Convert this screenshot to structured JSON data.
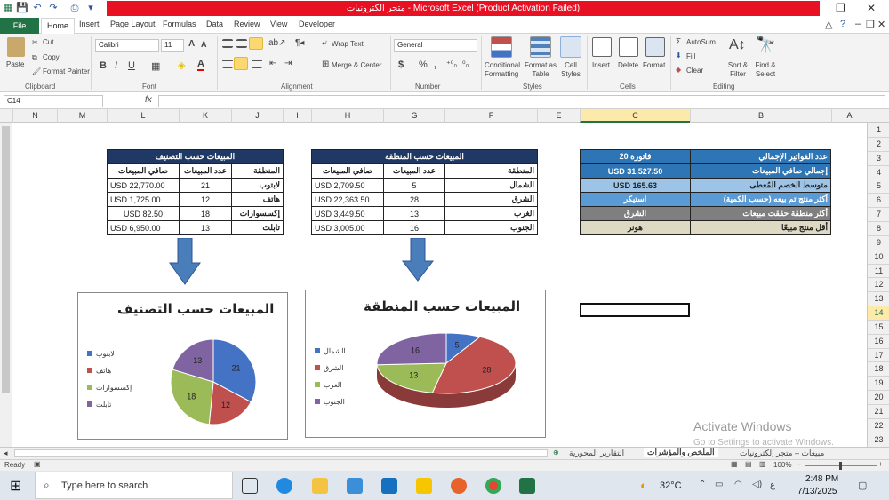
{
  "window": {
    "title": "متجر الكترونيات - Microsoft Excel (Product Activation Failed)"
  },
  "ribbon_tabs": [
    "File",
    "Home",
    "Insert",
    "Page Layout",
    "Formulas",
    "Data",
    "Review",
    "View",
    "Developer"
  ],
  "ribbon": {
    "paste": "Paste",
    "cut": "Cut",
    "copy": "Copy",
    "format_painter": "Format Painter",
    "font_name": "Calibri",
    "font_size": "11",
    "wrap_text": "Wrap Text",
    "merge_center": "Merge & Center",
    "number_format": "General",
    "conditional": "Conditional Formatting",
    "format_table": "Format as Table",
    "cell_styles": "Cell Styles",
    "insert": "Insert",
    "delete": "Delete",
    "format": "Format",
    "autosum": "AutoSum",
    "fill": "Fill",
    "clear": "Clear",
    "sort_filter": "Sort & Filter",
    "find_select": "Find & Select",
    "groups": [
      "Clipboard",
      "Font",
      "Alignment",
      "Number",
      "Styles",
      "Cells",
      "Editing"
    ]
  },
  "formula_bar": {
    "name_box": "C14",
    "fx": "fx",
    "value": ""
  },
  "columns": [
    "N",
    "M",
    "L",
    "K",
    "J",
    "I",
    "H",
    "G",
    "F",
    "E",
    "D",
    "C",
    "B",
    "A"
  ],
  "rows": [
    "1",
    "2",
    "3",
    "4",
    "5",
    "6",
    "7",
    "8",
    "9",
    "10",
    "11",
    "12",
    "13",
    "14",
    "15",
    "16",
    "17",
    "18",
    "19",
    "20",
    "21",
    "22",
    "23"
  ],
  "category_table": {
    "title": "المبيعات حسب التصنيف",
    "headers": [
      "المنطقة",
      "عدد المبيعات",
      "صافي المبيعات"
    ],
    "rows": [
      [
        "لابتوب",
        "21",
        "USD 22,770.00"
      ],
      [
        "هاتف",
        "12",
        "USD 1,725.00"
      ],
      [
        "إكسسوارات",
        "18",
        "USD 82.50"
      ],
      [
        "تابلت",
        "13",
        "USD 6,950.00"
      ]
    ]
  },
  "region_table": {
    "title": "المبيعات حسب المنطقة",
    "headers": [
      "المنطقة",
      "عدد المبيعات",
      "صافي المبيعات"
    ],
    "rows": [
      [
        "الشمال",
        "5",
        "USD 2,709.50"
      ],
      [
        "الشرق",
        "28",
        "USD 22,363.50"
      ],
      [
        "الغرب",
        "13",
        "USD 3,449.50"
      ],
      [
        "الجنوب",
        "16",
        "USD 3,005.00"
      ]
    ]
  },
  "kpi_table": {
    "rows": [
      [
        "عدد الفواتير الإجمالي",
        "فاتورة 20"
      ],
      [
        "إجمالي صافي المبيعات",
        "USD 31,527.50"
      ],
      [
        "متوسط الخصم المُعطى",
        "USD 165.63"
      ],
      [
        "أكثر منتج تم بيعه (حسب الكمية)",
        "استيكر"
      ],
      [
        "أكثر منطقة حققت مبيعات",
        "الشرق"
      ],
      [
        "أقل منتج مبيعًا",
        "هونر"
      ]
    ],
    "colors": {
      "label_bg": [
        "#2e75b6",
        "#2e75b6",
        "#9dc3e6",
        "#5b9bd5",
        "#7f7f7f",
        "#ddd9c3"
      ],
      "value_bg": [
        "#2e75b6",
        "#2e75b6",
        "#9dc3e6",
        "#5b9bd5",
        "#7f7f7f",
        "#ddd9c3"
      ]
    }
  },
  "chart_data": [
    {
      "type": "pie",
      "title": "المبيعات حسب التصنيف",
      "categories": [
        "لابتوب",
        "هاتف",
        "إكسسوارات",
        "تابلت"
      ],
      "values": [
        21,
        12,
        18,
        13
      ],
      "colors": [
        "#4472c4",
        "#c0504d",
        "#9bbb59",
        "#8064a2"
      ],
      "legend": "left"
    },
    {
      "type": "pie",
      "title": "المبيعات حسب المنطقة",
      "categories": [
        "الشمال",
        "الشرق",
        "الغرب",
        "الجنوب"
      ],
      "values": [
        5,
        28,
        13,
        16
      ],
      "colors": [
        "#4472c4",
        "#c0504d",
        "#9bbb59",
        "#8064a2"
      ],
      "legend": "left"
    }
  ],
  "sheet_tabs": [
    "مبيعات – متجر إلكترونيات",
    "الملخص والمؤشرات",
    "التقارير المحورية"
  ],
  "status": {
    "ready": "Ready",
    "zoom": "100%"
  },
  "watermark": {
    "line1": "Activate Windows",
    "line2": "Go to Settings to activate Windows."
  },
  "taskbar": {
    "search": "Type here to search",
    "temp": "32°C",
    "time": "2:48 PM",
    "date": "7/13/2025",
    "lang": "ع"
  }
}
